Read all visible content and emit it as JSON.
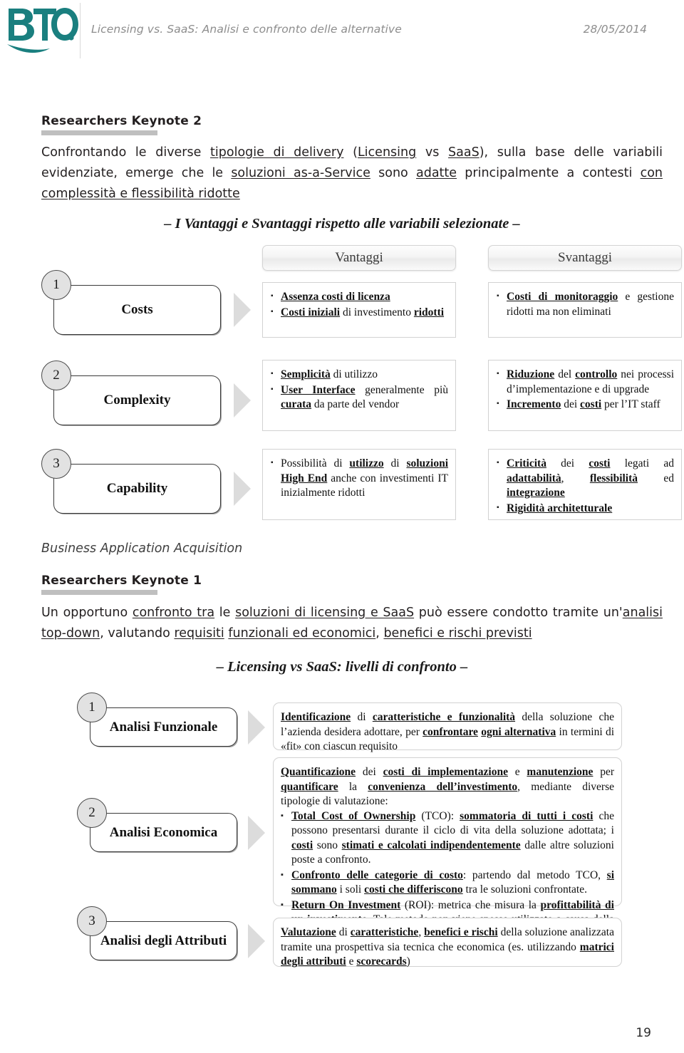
{
  "header": {
    "logo_text": "BTO",
    "logo_color": "#1a7f7f",
    "title": "Licensing vs. SaaS: Analisi e confronto delle alternative",
    "date": "28/05/2014"
  },
  "keynote2": {
    "heading": "Researchers Keynote 2",
    "paragraph_html": "Confrontando le diverse <u>tipologie di delivery</u> (<u>Licensing</u> vs <u>SaaS</u>), sulla base delle variabili evidenziate, emerge che le <u>soluzioni as-a-Service</u> sono <u>adatte</u> principalmente a contesti <u>con complessit&agrave; e flessibilit&agrave; ridotte</u>",
    "subtitle": "– I Vantaggi e Svantaggi rispetto alle variabili selezionate –"
  },
  "matrix": {
    "col_vantaggi": "Vantaggi",
    "col_svantaggi": "Svantaggi",
    "rows": [
      {
        "number": "1",
        "label": "Costs",
        "vantaggi_html": "<ul><li><span class=\"bu\">Assenza costi di licenza</span></li><li><span class=\"bu\">Costi iniziali</span> di investimento <span class=\"bu\">ridotti</span></li></ul>",
        "svantaggi_html": "<ul><li><span class=\"bu\">Costi di monitoraggio</span> e gestione ridotti ma non eliminati</li></ul>"
      },
      {
        "number": "2",
        "label": "Complexity",
        "vantaggi_html": "<ul><li><span class=\"bu\">Semplicit&agrave;</span> di utilizzo</li><li><span class=\"bu\">User Interface</span> generalmente pi&ugrave; <span class=\"bu\">curata</span> da parte del vendor</li></ul>",
        "svantaggi_html": "<ul><li><span class=\"bu\">Riduzione</span> del <span class=\"bu\">controllo</span> nei processi d’implementazione e di upgrade</li><li><span class=\"bu\">Incremento</span> dei <span class=\"bu\">costi</span> per l’IT staff</li></ul>"
      },
      {
        "number": "3",
        "label": "Capability",
        "vantaggi_html": "<ul><li>Possibilit&agrave; di <span class=\"bu\">utilizzo</span> di <span class=\"bu\">soluzioni High End</span> anche con investimenti IT inizialmente ridotti</li></ul>",
        "svantaggi_html": "<ul><li><span class=\"bu\">Criticit&agrave;</span> dei <span class=\"bu\">costi</span> legati ad <span class=\"bu\">adattabilit&agrave;</span>, <span class=\"bu\">flessibilit&agrave;</span> ed <span class=\"bu\">integrazione</span></li><li><span class=\"bu\">Rigidit&agrave; architetturale</span></li></ul>"
      }
    ]
  },
  "keynote1": {
    "section_caption": "Business Application Acquisition",
    "heading": "Researchers Keynote 1",
    "paragraph_html": "Un opportuno <u>confronto tra</u> le <u>soluzioni di licensing e SaaS</u> pu&ograve; essere condotto tramite un'<u>analisi top-down</u>, valutando <u>requisiti</u> <u>funzionali ed economici</u>, <u>benefici e rischi previsti</u>",
    "subtitle": "– Licensing vs SaaS: livelli di confronto –"
  },
  "levels": {
    "rows": [
      {
        "number": "1",
        "label": "Analisi Funzionale",
        "body_html": "<p><span class=\"bu\">Identificazione</span> di <span class=\"bu\">caratteristiche e funzionalit&agrave;</span> della soluzione che l’azienda desidera adottare, per <span class=\"bu\">confrontare</span> <span class=\"bu\">ogni alternativa</span> in termini di &laquo;fit&raquo; con ciascun requisito</p>"
      },
      {
        "number": "2",
        "label": "Analisi Economica",
        "body_html": "<p><span class=\"bu\">Quantificazione</span> dei <span class=\"bu\">costi di implementazione</span> e <span class=\"bu\">manutenzione</span> per <span class=\"bu\">quantificare</span> la <span class=\"bu\">convenienza dell’investimento</span>, mediante diverse tipologie di valutazione:</p><ul><li class=\"sq\"><span class=\"bu\">Total Cost of Ownership</span> (TCO): <span class=\"bu\">sommatoria di tutti i costi</span> che possono presentarsi durante il ciclo di vita della soluzione adottata; i <span class=\"bu\">costi</span> sono <span class=\"bu\">stimati e calcolati indipendentemente</span> dalle altre soluzioni poste a confronto.</li><li class=\"sq\"><span class=\"bu\">Confronto delle categorie di costo</span>: partendo dal metodo TCO, <span class=\"bu\">si sommano</span> i soli <span class=\"bu\">costi che differiscono</span> tra le soluzioni confrontate.</li><li class=\"sq\"><span class=\"bu\">Return On Investment</span> (ROI): metrica che misura la <span class=\"bu\">profittabilit&agrave; di un investimento</span>. Tale metodo non viene spesso utilizzato a causa della difficolt&agrave; nella stima dei benefici</li></ul>"
      },
      {
        "number": "3",
        "label": "Analisi degli Attributi",
        "body_html": "<p><span class=\"bu\">Valutazione</span> di <span class=\"bu\">caratteristiche</span>, <span class=\"bu\">benefici e rischi</span> della soluzione analizzata tramite una prospettiva sia tecnica che economica (es. utilizzando <span class=\"bu\">matrici degli attributi</span> e <span class=\"bu\">scorecards</span>)</p>"
      }
    ]
  },
  "footer": {
    "page_number": "19"
  }
}
